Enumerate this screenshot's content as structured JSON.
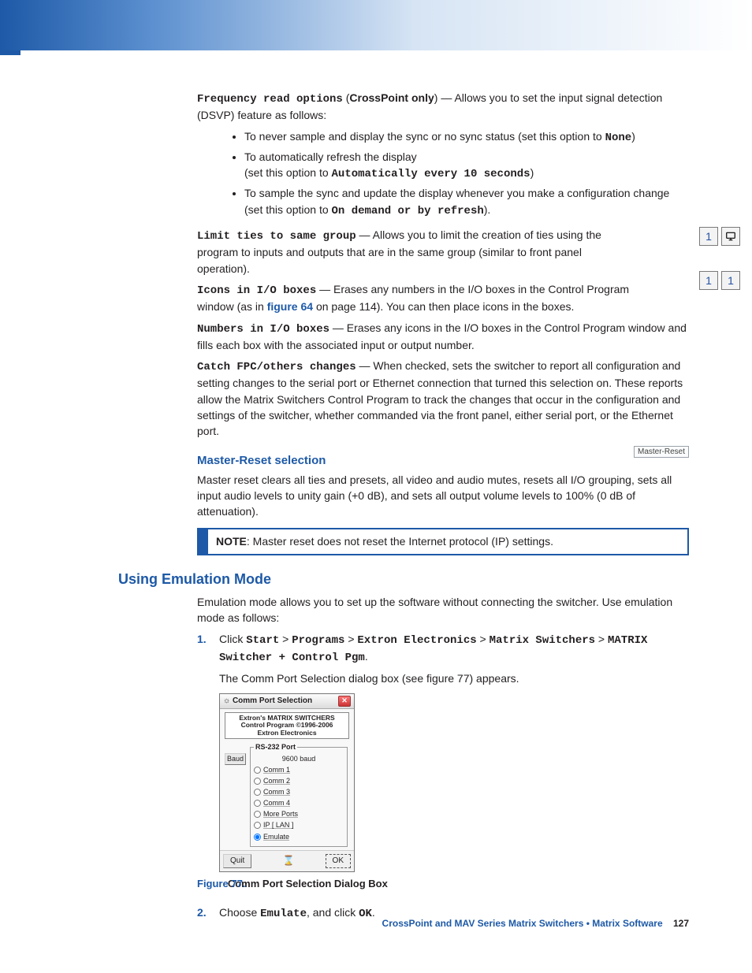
{
  "freq_options": {
    "label": "Frequency read options",
    "paren": "CrossPoint only",
    "desc": " — Allows you to set the input signal detection (DSVP) feature as follows:",
    "bullets": [
      {
        "pre": "To never sample and display the sync or no sync status (set this option to ",
        "mono": "None",
        "post": ")"
      },
      {
        "pre": "To automatically refresh the display",
        "line2pre": "(set this option to ",
        "mono": "Automatically every 10 seconds",
        "line2post": ")"
      },
      {
        "pre": "To sample the sync and update the display whenever you make a configuration change (set this option to ",
        "mono": "On demand or by refresh",
        "post": ")."
      }
    ]
  },
  "limit_ties": {
    "label": "Limit ties to same group",
    "desc": " — Allows you to limit the creation of ties using the program to inputs and outputs that are in the same group (similar to front panel operation).",
    "badge": "1"
  },
  "icons_io": {
    "label": "Icons in I/O boxes",
    "desc_pre": " — Erases any numbers in the I/O boxes in the Control Program window (as in ",
    "link": "figure 64",
    "desc_post": " on page 114). You can then place icons in the boxes.",
    "badge_left": "1",
    "badge_right": "1"
  },
  "numbers_io": {
    "label": "Numbers in I/O boxes",
    "desc": " — Erases any icons in the I/O boxes in the Control Program window and fills each box with the associated input or output number."
  },
  "catch_fpc": {
    "label": "Catch FPC/others changes",
    "desc": " — When checked, sets the switcher to report all configuration and setting changes to the serial port or Ethernet connection that turned this selection on. These reports allow the Matrix Switchers Control Program to track the changes that occur in the configuration and settings of the switcher, whether commanded via the front panel, either serial port, or the Ethernet port."
  },
  "master_reset": {
    "heading": "Master-Reset selection",
    "badge": "Master-Reset",
    "desc": "Master reset clears all ties and presets, all video and audio mutes, resets all I/O grouping, sets all input audio levels to unity gain (+0 dB), and sets all output volume levels to 100% (0 dB of attenuation).",
    "note_label": "NOTE",
    "note": ":  Master reset does not reset the Internet protocol (IP) settings."
  },
  "emulation": {
    "heading": "Using Emulation Mode",
    "intro": "Emulation mode allows you to set up the software without connecting the switcher. Use emulation mode as follows:",
    "steps": [
      {
        "num": "1.",
        "pre": "Click ",
        "path": [
          "Start",
          "Programs",
          "Extron Electronics",
          "Matrix Switchers",
          "MATRIX Switcher + Control Pgm"
        ],
        "sep": " > ",
        "after": "The Comm Port Selection dialog box (see figure 77) appears."
      },
      {
        "num": "2.",
        "pre": "Choose ",
        "mono1": "Emulate",
        "mid": ", and click ",
        "mono2": "OK",
        "post": "."
      }
    ]
  },
  "dialog": {
    "title": "Comm Port Selection",
    "banner1": "Extron's MATRIX SWITCHERS",
    "banner2": "Control Program   ©1996-2006",
    "banner3": "Extron Electronics",
    "baud_btn": "Baud",
    "group_label": "RS-232 Port",
    "baud_line": "9600 baud",
    "options": [
      "Comm 1",
      "Comm 2",
      "Comm 3",
      "Comm 4",
      "More Ports",
      "IP [ LAN ]",
      "Emulate"
    ],
    "selected_index": 6,
    "quit": "Quit",
    "ok": "OK"
  },
  "figure": {
    "num": "Figure 77.",
    "caption": "Comm Port Selection Dialog Box"
  },
  "footer": {
    "text": "CrossPoint and MAV Series Matrix Switchers • Matrix Software",
    "page": "127"
  }
}
